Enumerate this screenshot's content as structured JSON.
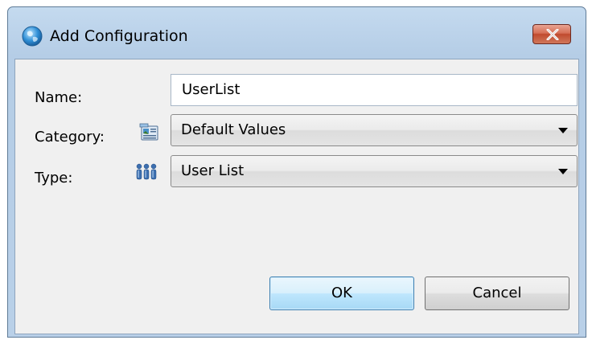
{
  "window": {
    "title": "Add Configuration",
    "close_icon": "close-icon"
  },
  "form": {
    "name_label": "Name:",
    "name_value": "UserList",
    "category_label": "Category:",
    "category_icon": "category-icon",
    "category_value": "Default Values",
    "type_label": "Type:",
    "type_icon": "users-icon",
    "type_value": "User List"
  },
  "buttons": {
    "ok_label": "OK",
    "cancel_label": "Cancel"
  },
  "colors": {
    "title_bar": "#c4daef",
    "close_button": "#c04a2e",
    "ok_button_border": "#3c7fb1",
    "dialog_body": "#f0f0f0"
  }
}
